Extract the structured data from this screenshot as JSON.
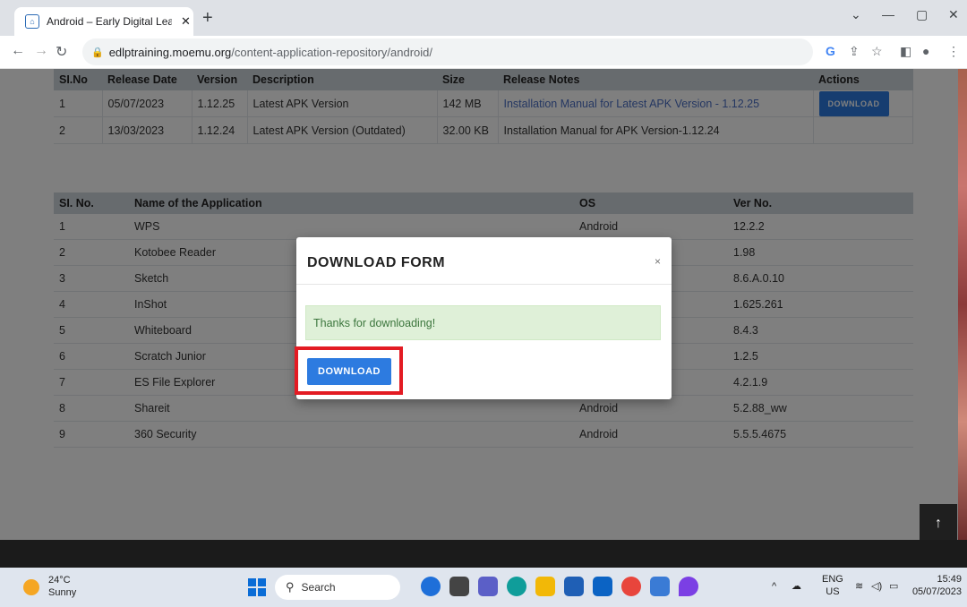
{
  "browser": {
    "tab_title": "Android – Early Digital Learning I",
    "tab_close": "✕",
    "new_tab": "+",
    "url_host": "edlptraining.moemu.org",
    "url_path": "/content-application-repository/android/"
  },
  "releases_table": {
    "headers": [
      "SI.No",
      "Release Date",
      "Version",
      "Description",
      "Size",
      "Release Notes",
      "Actions"
    ],
    "rows": [
      {
        "no": "1",
        "date": "05/07/2023",
        "version": "1.12.25",
        "description": "Latest APK Version",
        "size": "142 MB",
        "notes": "Installation Manual for Latest APK Version - 1.12.25",
        "action": "DOWNLOAD"
      },
      {
        "no": "2",
        "date": "13/03/2023",
        "version": "1.12.24",
        "description": "Latest APK Version (Outdated)",
        "size": "32.00 KB",
        "notes": "Installation Manual for APK Version-1.12.24",
        "action": ""
      }
    ]
  },
  "apps_table": {
    "headers": [
      "SI. No.",
      "Name of the Application",
      "OS",
      "Ver No."
    ],
    "rows": [
      {
        "no": "1",
        "name": "WPS",
        "os": "Android",
        "ver": "12.2.2"
      },
      {
        "no": "2",
        "name": "Kotobee Reader",
        "os": "",
        "ver": "1.98"
      },
      {
        "no": "3",
        "name": "Sketch",
        "os": "",
        "ver": "8.6.A.0.10"
      },
      {
        "no": "4",
        "name": "InShot",
        "os": "",
        "ver": "1.625.261"
      },
      {
        "no": "5",
        "name": "Whiteboard",
        "os": "",
        "ver": "8.4.3"
      },
      {
        "no": "6",
        "name": "Scratch Junior",
        "os": "",
        "ver": "1.2.5"
      },
      {
        "no": "7",
        "name": "ES File Explorer",
        "os": "",
        "ver": "4.2.1.9"
      },
      {
        "no": "8",
        "name": "Shareit",
        "os": "Android",
        "ver": "5.2.88_ww"
      },
      {
        "no": "9",
        "name": "360 Security",
        "os": "Android",
        "ver": "5.5.5.4675"
      }
    ]
  },
  "modal": {
    "title": "DOWNLOAD FORM",
    "close": "×",
    "message": "Thanks for downloading!",
    "button": "DOWNLOAD"
  },
  "back_to_top": "↑",
  "taskbar": {
    "temperature": "24°C",
    "condition": "Sunny",
    "search_placeholder": "Search",
    "lang": "ENG",
    "region": "US",
    "time": "15:49",
    "date": "05/07/2023"
  },
  "colors": {
    "accent": "#2d7be0",
    "highlight": "#e31b23",
    "alert_bg": "#dff0d8"
  }
}
